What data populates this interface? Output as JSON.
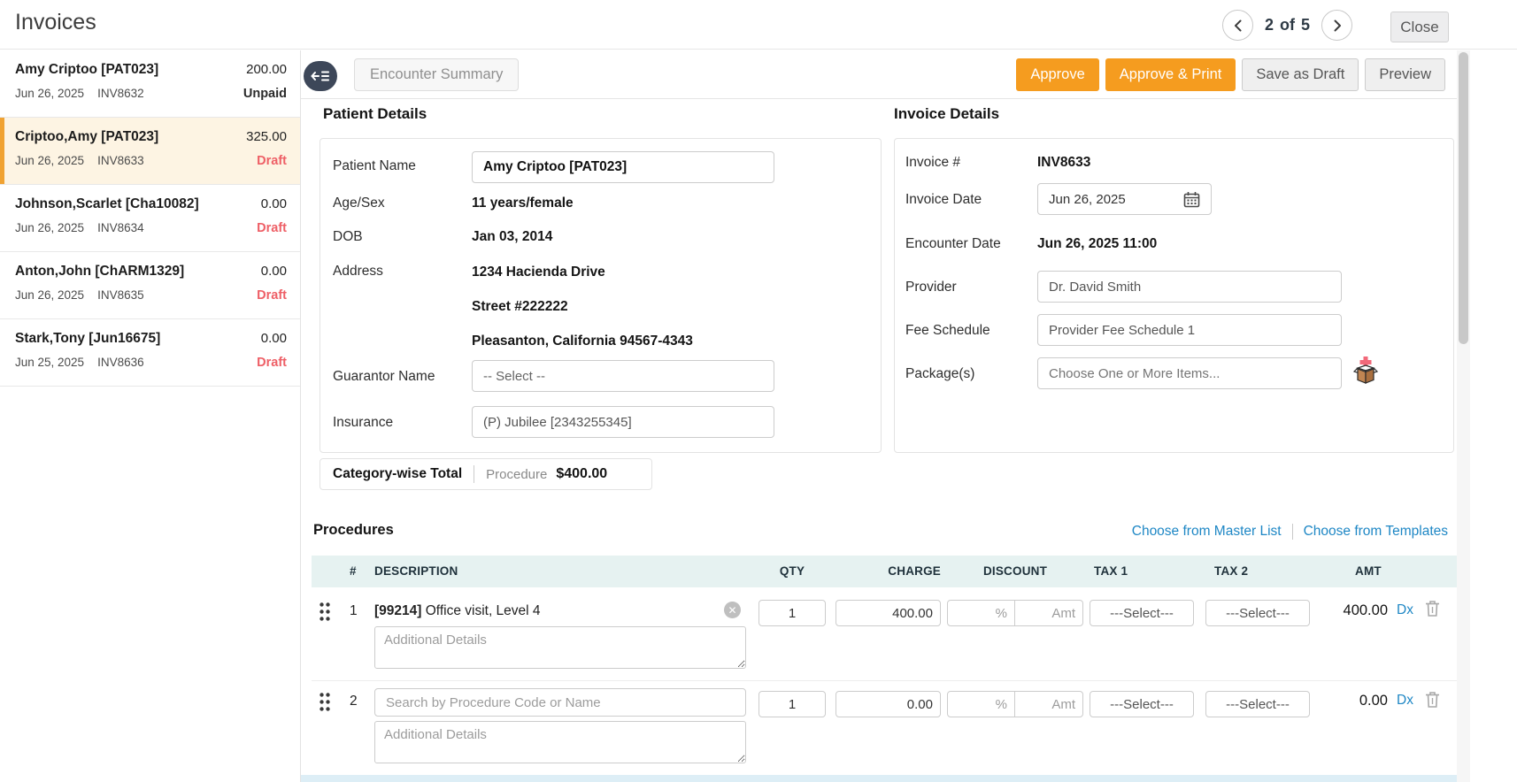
{
  "header": {
    "title": "Invoices",
    "pagination": {
      "current": "2",
      "separator": "of",
      "total": "5"
    },
    "close_label": "Close"
  },
  "sidebar": {
    "items": [
      {
        "name": "Amy Criptoo [PAT023]",
        "amount": "200.00",
        "date": "Jun 26, 2025",
        "invoice_no": "INV8632",
        "status": "Unpaid",
        "selected": false
      },
      {
        "name": "Criptoo,Amy [PAT023]",
        "amount": "325.00",
        "date": "Jun 26, 2025",
        "invoice_no": "INV8633",
        "status": "Draft",
        "selected": true
      },
      {
        "name": "Johnson,Scarlet [Cha10082]",
        "amount": "0.00",
        "date": "Jun 26, 2025",
        "invoice_no": "INV8634",
        "status": "Draft",
        "selected": false
      },
      {
        "name": "Anton,John [ChARM1329]",
        "amount": "0.00",
        "date": "Jun 26, 2025",
        "invoice_no": "INV8635",
        "status": "Draft",
        "selected": false
      },
      {
        "name": "Stark,Tony [Jun16675]",
        "amount": "0.00",
        "date": "Jun 25, 2025",
        "invoice_no": "INV8636",
        "status": "Draft",
        "selected": false
      }
    ]
  },
  "toolbar": {
    "encounter_summary_label": "Encounter Summary",
    "approve_label": "Approve",
    "approve_print_label": "Approve & Print",
    "save_draft_label": "Save as Draft",
    "preview_label": "Preview"
  },
  "patient_details": {
    "title": "Patient Details",
    "patient_name_label": "Patient Name",
    "patient_name_value": "Amy Criptoo [PAT023]",
    "age_sex_label": "Age/Sex",
    "age_sex_value": "11 years/female",
    "dob_label": "DOB",
    "dob_value": "Jan 03, 2014",
    "address_label": "Address",
    "address_line1": "1234 Hacienda Drive",
    "address_line2": "Street #222222",
    "address_line3": "Pleasanton, California 94567-4343",
    "guarantor_label": "Guarantor Name",
    "guarantor_value": "-- Select --",
    "insurance_label": "Insurance",
    "insurance_value": "(P) Jubilee [2343255345]"
  },
  "invoice_details": {
    "title": "Invoice Details",
    "invoice_no_label": "Invoice #",
    "invoice_no_value": "INV8633",
    "invoice_date_label": "Invoice Date",
    "invoice_date_value": "Jun 26, 2025",
    "encounter_date_label": "Encounter Date",
    "encounter_date_value": "Jun 26, 2025 11:00",
    "provider_label": "Provider",
    "provider_value": "Dr. David Smith",
    "fee_schedule_label": "Fee Schedule",
    "fee_schedule_value": "Provider Fee Schedule 1",
    "packages_label": "Package(s)",
    "packages_placeholder": "Choose One or More Items..."
  },
  "category_total": {
    "label": "Category-wise Total",
    "category": "Procedure",
    "amount": "$400.00"
  },
  "procedures": {
    "title": "Procedures",
    "choose_master_label": "Choose from Master List",
    "choose_templates_label": "Choose from Templates",
    "columns": {
      "num": "#",
      "description": "DESCRIPTION",
      "qty": "QTY",
      "charge": "CHARGE",
      "discount": "DISCOUNT",
      "tax1": "TAX 1",
      "tax2": "TAX 2",
      "amt": "AMT"
    },
    "discount_pct_placeholder": "%",
    "discount_amt_placeholder": "Amt",
    "tax_select_value": "---Select---",
    "dx_label": "Dx",
    "additional_details_placeholder": "Additional Details",
    "search_placeholder": "Search by Procedure Code or Name",
    "rows": [
      {
        "num": "1",
        "code": "[99214]",
        "name": " Office visit, Level 4",
        "qty": "1",
        "charge": "400.00",
        "amt": "400.00"
      },
      {
        "num": "2",
        "qty": "1",
        "charge": "0.00",
        "amt": "0.00"
      }
    ]
  },
  "icons": {
    "remove_glyph": "✕"
  },
  "colors": {
    "accent_orange": "#F59C1F",
    "selected_bar_orange": "#F0A232",
    "draft_red": "#EE5F66",
    "link_blue": "#1E87C5",
    "selected_item_bg": "#FDF4E3",
    "table_header_bg": "#E6F2F1",
    "collapse_pill": "#3D4759"
  }
}
